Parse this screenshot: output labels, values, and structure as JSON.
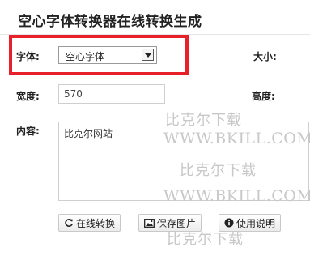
{
  "page": {
    "title": "空心字体转换器在线转换生成"
  },
  "form": {
    "font_label": "字体:",
    "font_value": "空心字体",
    "size_label": "大小:",
    "width_label": "宽度:",
    "width_value": "570",
    "height_label": "高度:",
    "content_label": "内容:",
    "content_value": "比克尔网站"
  },
  "buttons": {
    "convert": "在线转换",
    "save_image": "保存图片",
    "help": "使用说明"
  },
  "watermark": {
    "text_cn": "比克尔下载",
    "text_en": "WWW.BKILL.COM"
  },
  "colors": {
    "highlight": "#e8202a",
    "watermark": "#c8c8c8"
  },
  "icons": [
    "refresh-icon",
    "image-icon",
    "info-icon",
    "chevron-down-icon"
  ]
}
